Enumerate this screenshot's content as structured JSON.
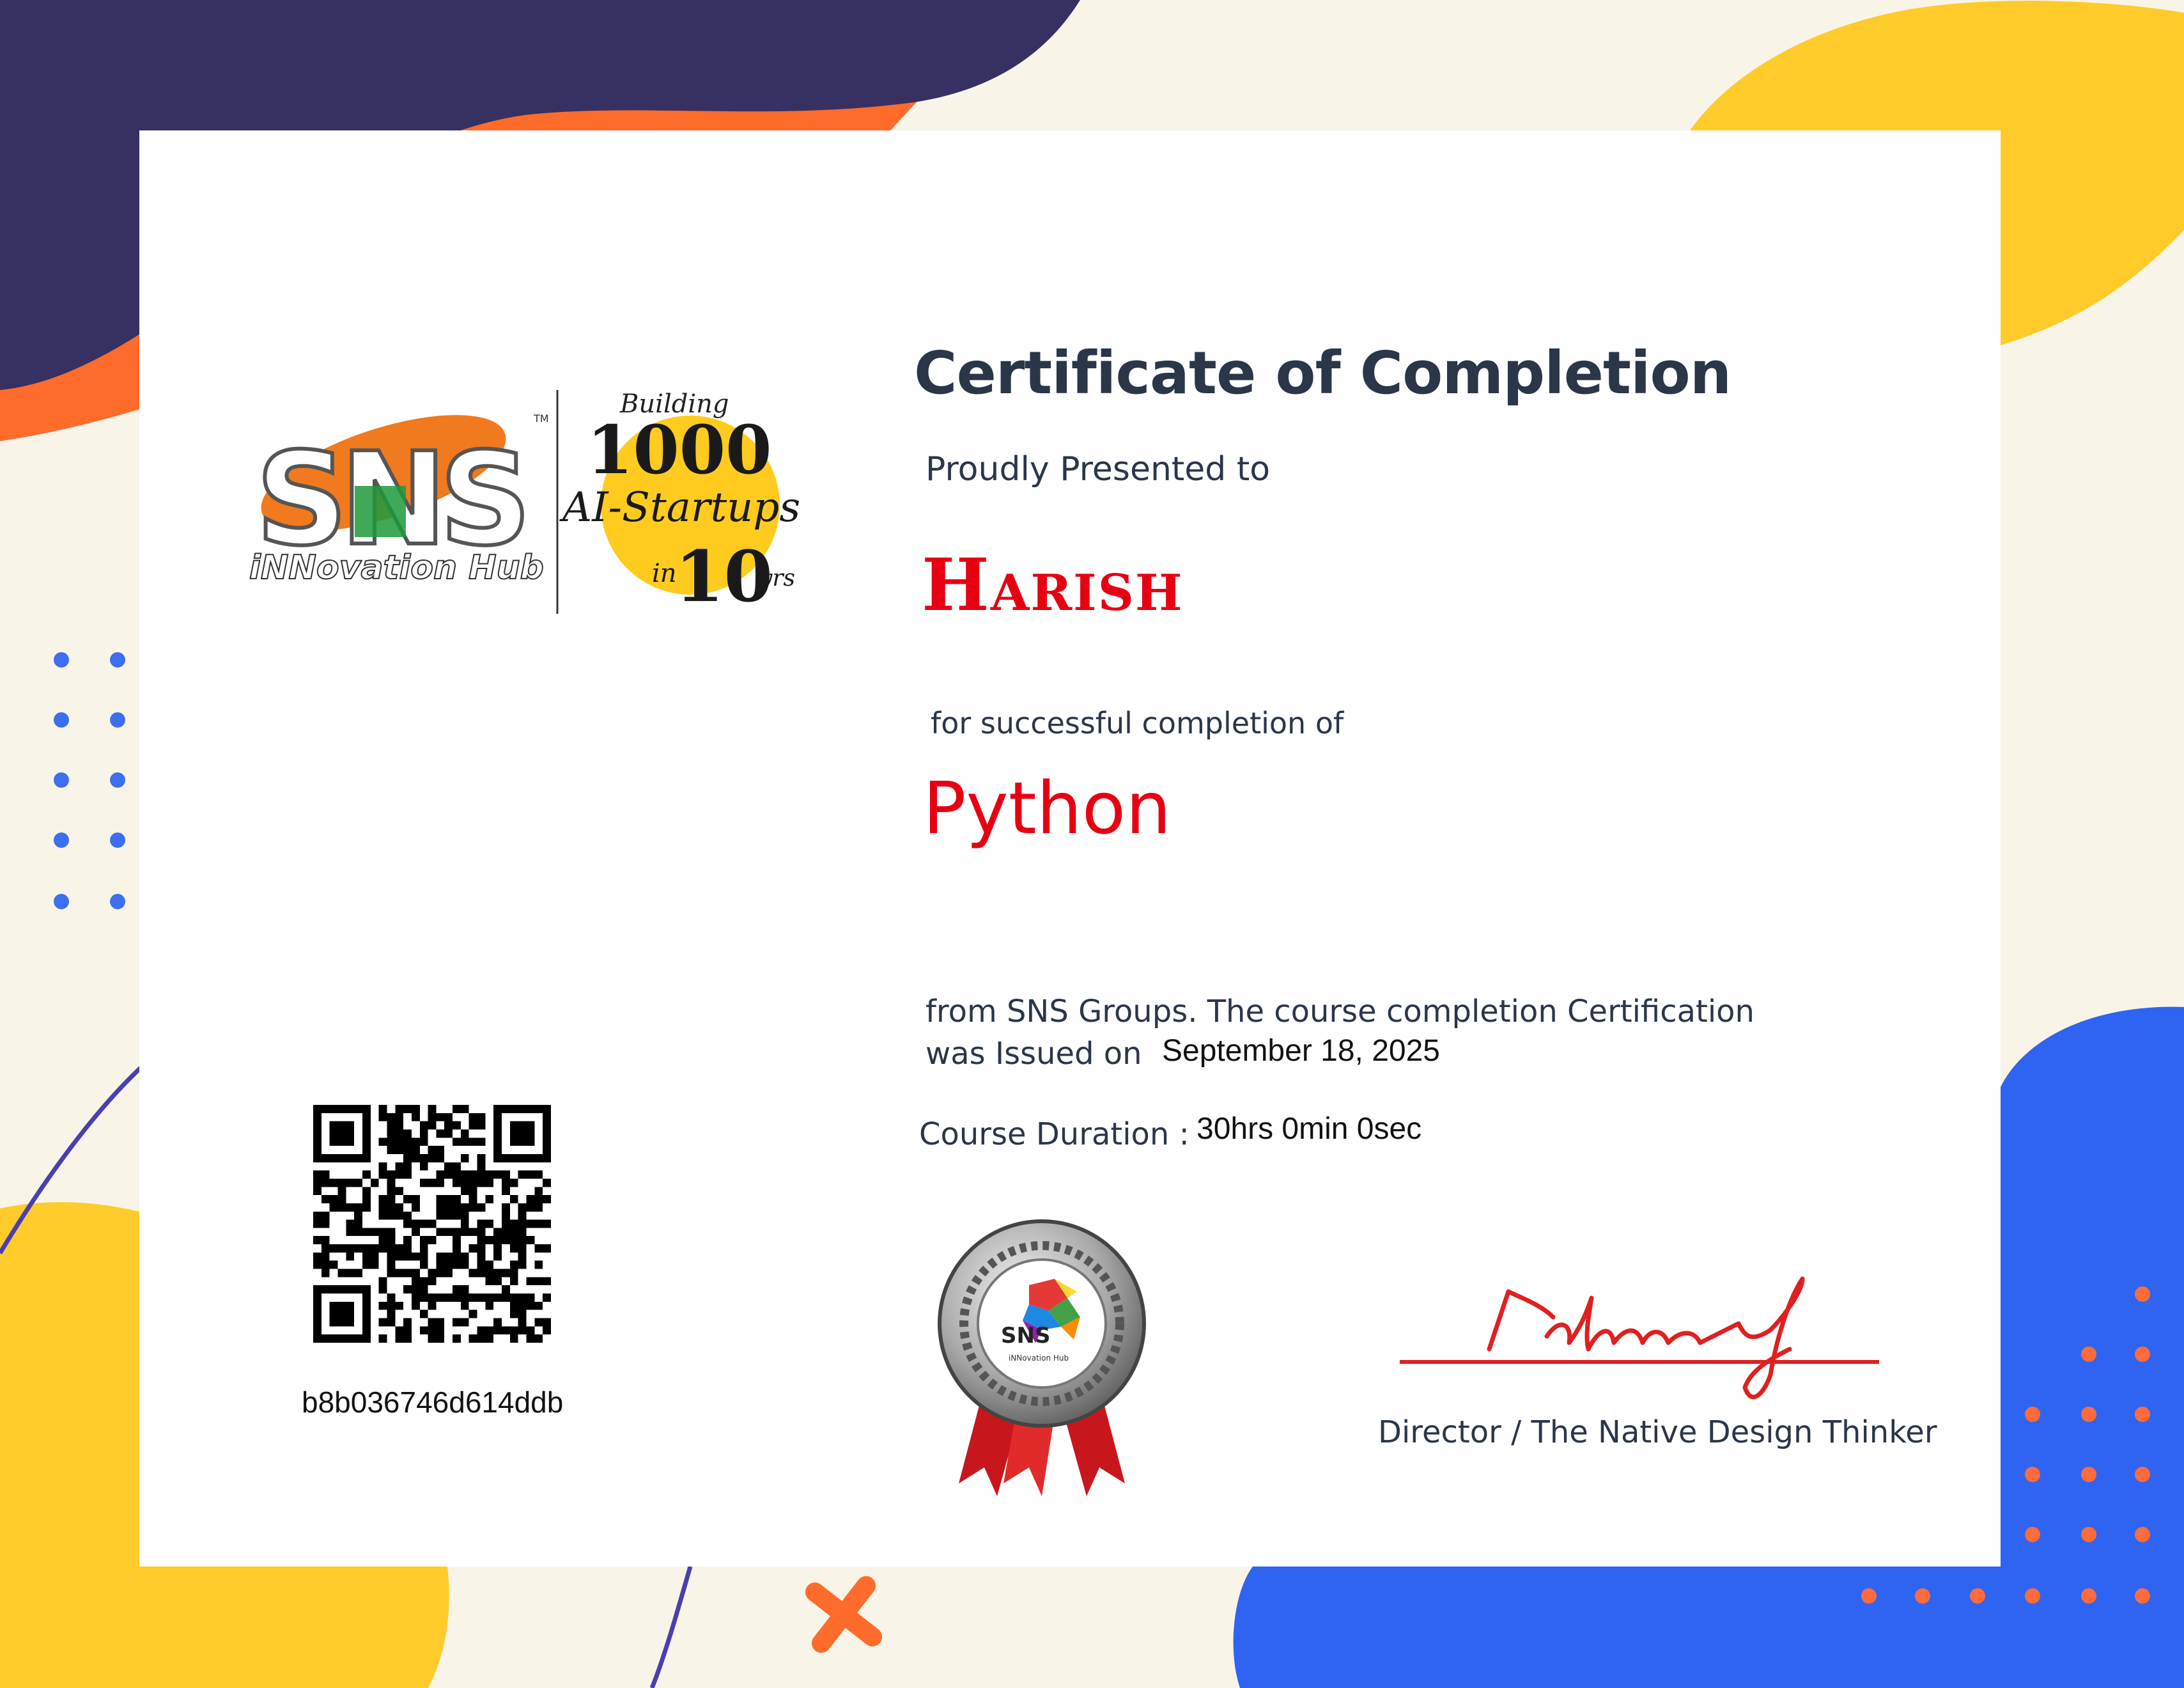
{
  "certificate": {
    "title": "Certificate of Completion",
    "presented_label": "Proudly Presented to",
    "recipient": "Harish",
    "completion_label": "for successful completion of",
    "course": "Python",
    "from_line": "from SNS Groups. The course completion Certification",
    "issued_label": "was Issued on",
    "issued_date": "September 18, 2025",
    "duration_label": "Course Duration :",
    "duration_value": "30hrs 0min 0sec",
    "certificate_id": "b8b036746d614ddb",
    "signatory_title": "Director / The Native Design Thinker"
  },
  "logo": {
    "brand": "SNS",
    "tagline": "iNNovation Hub",
    "trademark": "TM",
    "slogan_top": "Building",
    "slogan_number": "1000",
    "slogan_middle": "AI-Startups",
    "slogan_in": "in",
    "slogan_years": "10",
    "slogan_yrs": "yrs"
  },
  "medal": {
    "brand": "SNS",
    "tagline": "iNNovation Hub"
  },
  "colors": {
    "navy": "#373063",
    "orange": "#ff6b2b",
    "yellow": "#ffcb2b",
    "blue": "#2f64f2",
    "red_accent": "#e60012",
    "text_dark": "#2b3648",
    "dot_blue": "#3c6ff0",
    "dot_orange": "#ff6b3a"
  },
  "icons": {
    "medal": "award-medal-icon",
    "qr": "qr-code-icon",
    "signature": "signature-mark"
  }
}
